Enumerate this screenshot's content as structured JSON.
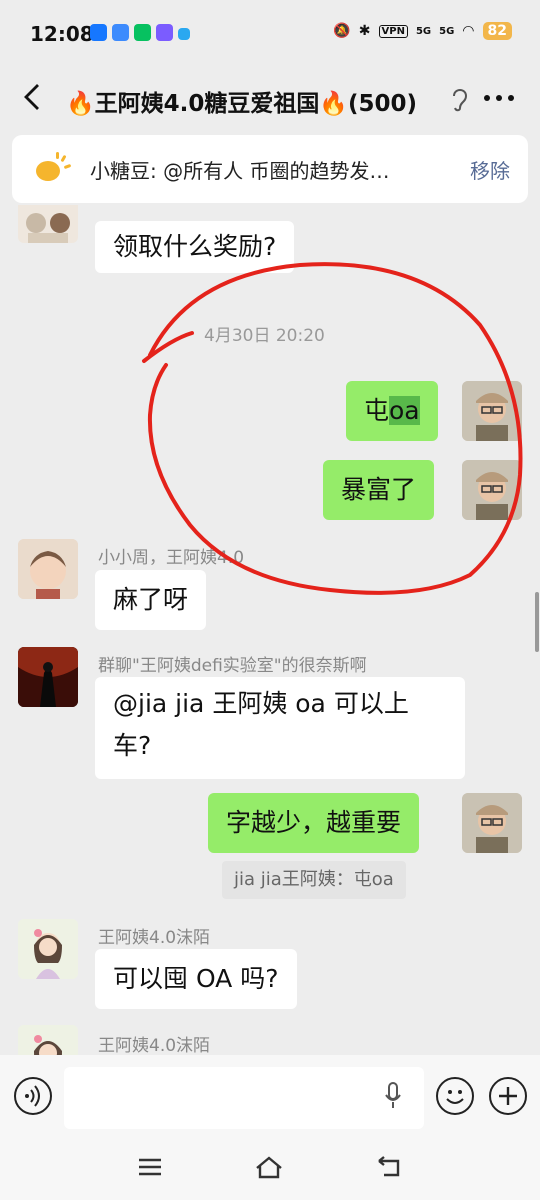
{
  "status_bar": {
    "time": "12:08",
    "vpn": "VPN",
    "signal1": "5G",
    "signal2": "5G",
    "battery": "82"
  },
  "header": {
    "back": "<",
    "title": "🔥王阿姨4.0糖豆爱祖国🔥(500)",
    "more": "..."
  },
  "pinned": {
    "text": "小糖豆: @所有人 币圈的趋势发…",
    "remove": "移除"
  },
  "messages": {
    "m1_text": "领取什么奖励?",
    "timestamp": "4月30日 20:20",
    "m2_prefix": "屯",
    "m2_highlight": "oa",
    "m3_text": "暴富了",
    "m4_sender": "小小周，王阿姨4.0",
    "m4_text": "麻了呀",
    "m5_sender": "群聊\"王阿姨defi实验室\"的很奈斯啊",
    "m5_line1": "@jia jia 王阿姨  oa 可以上",
    "m5_line2": "车?",
    "m6_text": "字越少，越重要",
    "m6_quote": "jia jia王阿姨：屯oa",
    "m7_sender": "王阿姨4.0沫陌",
    "m7_text": "可以囤 OA 吗?",
    "m8_sender": "王阿姨4.0沫陌"
  },
  "input": {
    "placeholder": ""
  },
  "colors": {
    "chat_bg": "#ededed",
    "bubble_green": "#95ec69",
    "highlight": "#58b94a",
    "link_blue": "#576b95",
    "annotation_red": "#e4231b"
  }
}
